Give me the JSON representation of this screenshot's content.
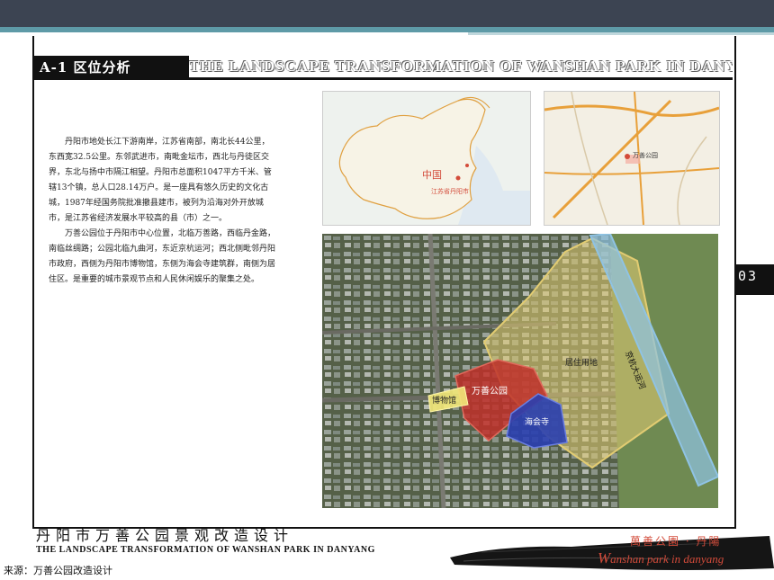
{
  "header": {
    "section_title": "A-1 区位分析",
    "section_title_en": "THE LANDSCAPE TRANSFORMATION OF WANSHAN PARK IN DANYANG"
  },
  "body_text": {
    "paragraph_1": "丹阳市地处长江下游南岸，江苏省南部，南北长44公里，东西宽32.5公里。东邻武进市，南毗金坛市，西北与丹徒区交界，东北与扬中市隔江相望。丹阳市总面积1047平方千米、管辖13个镇，总人口28.14万户。是一座具有悠久历史的文化古城，1987年经国务院批准撤县建市，被列为沿海对外开放城市，是江苏省经济发展水平较高的县（市）之一。",
    "paragraph_2": "万善公园位于丹阳市中心位置，北临万善路，西临丹金路，南临丝绸路；公园北临九曲河，东近京杭运河；西北侧毗邻丹阳市政府，西侧为丹阳市博物馆，东侧为海会寺建筑群，南侧为居住区。是重要的城市景观节点和人民休闲娱乐的聚集之处。"
  },
  "map_china": {
    "label_country": "中国",
    "label_province": "江苏省丹阳市"
  },
  "map_city": {
    "label_park": "万善公园"
  },
  "aerial": {
    "label_residential": "居住用地",
    "label_canal": "京杭大运河",
    "label_park": "万善公园",
    "label_museum": "博物馆",
    "label_temple": "海会寺"
  },
  "side_tab": {
    "page_number": "03"
  },
  "footer": {
    "title_cn": "丹阳市万善公园景观改造设计",
    "title_en": "THE LANDSCAPE TRANSFORMATION OF WANSHAN PARK IN DANYANG",
    "logo_cn": "萬善公園 · 丹陽",
    "logo_en_initial": "W",
    "logo_en_rest": "anshan park in danyang"
  },
  "source_note": "来源：万善公园改造设计",
  "colors": {
    "topbar": "#3c4452",
    "accent": "#5e9aa7",
    "residential": "#e2cc72",
    "park": "#c0302a",
    "temple": "#2a3fb0",
    "museum": "#f3e97a",
    "canal": "#8fc3e4",
    "logo": "#d34b3a"
  }
}
